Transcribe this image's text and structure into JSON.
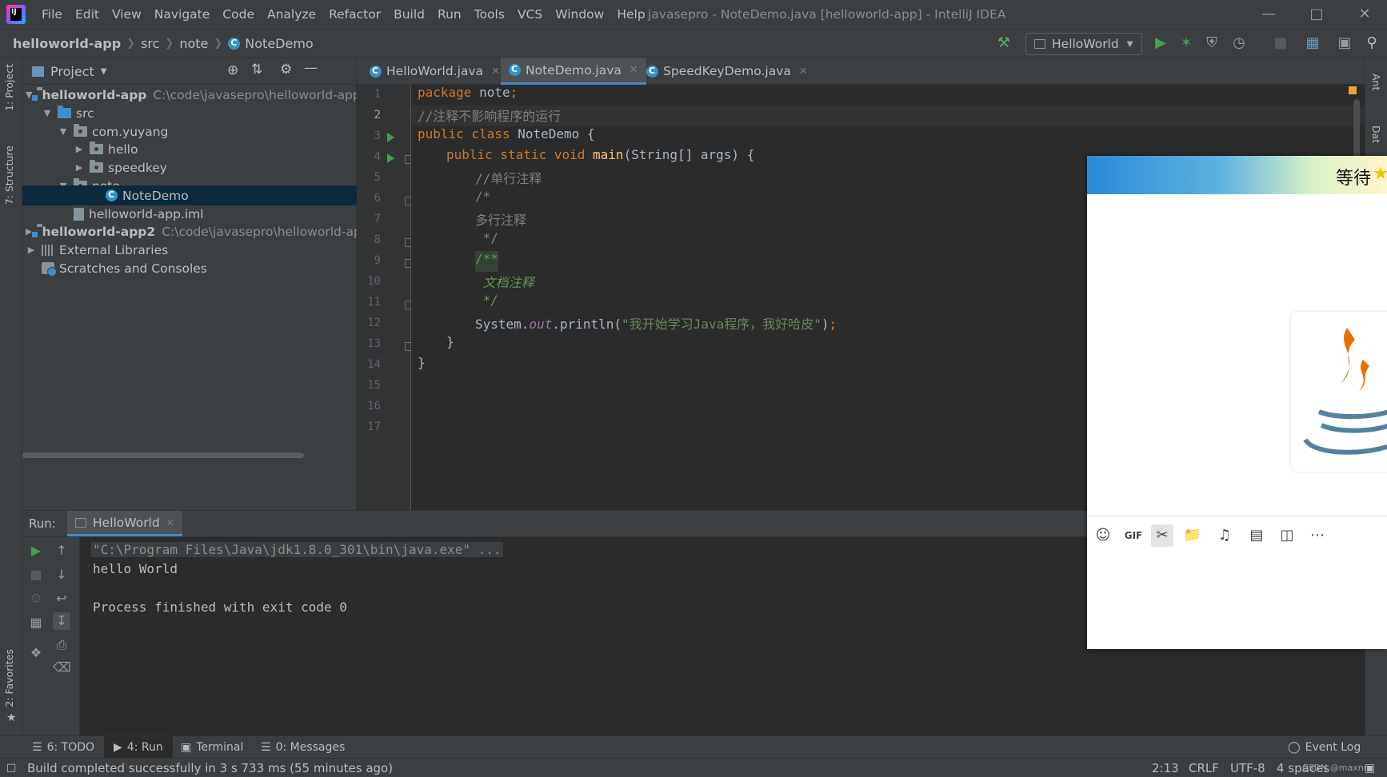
{
  "window": {
    "title": "javasepro - NoteDemo.java [helloworld-app] - IntelliJ IDEA",
    "menu": [
      "File",
      "Edit",
      "View",
      "Navigate",
      "Code",
      "Analyze",
      "Refactor",
      "Build",
      "Run",
      "Tools",
      "VCS",
      "Window",
      "Help"
    ]
  },
  "breadcrumb": [
    "helloworld-app",
    "src",
    "note",
    "NoteDemo"
  ],
  "toolbar": {
    "run_config": "HelloWorld"
  },
  "tool_tabs": {
    "project": "1: Project",
    "structure": "7: Structure",
    "favorites": "2: Favorites",
    "ant": "Ant",
    "database": "Dat"
  },
  "project": {
    "title": "Project",
    "tree": [
      {
        "label": "helloworld-app",
        "path": "C:\\code\\javasepro\\helloworld-app"
      },
      {
        "label": "src"
      },
      {
        "label": "com.yuyang"
      },
      {
        "label": "hello"
      },
      {
        "label": "speedkey"
      },
      {
        "label": "note"
      },
      {
        "label": "NoteDemo"
      },
      {
        "label": "helloworld-app.iml"
      },
      {
        "label": "helloworld-app2",
        "path": "C:\\code\\javasepro\\helloworld-app"
      },
      {
        "label": "External Libraries"
      },
      {
        "label": "Scratches and Consoles"
      }
    ]
  },
  "editor": {
    "tabs": [
      "HelloWorld.java",
      "NoteDemo.java",
      "SpeedKeyDemo.java"
    ],
    "active_tab": 1,
    "line_numbers": [
      "1",
      "2",
      "3",
      "4",
      "5",
      "6",
      "7",
      "8",
      "9",
      "10",
      "11",
      "12",
      "13",
      "14",
      "15",
      "16",
      "17"
    ],
    "current_line": 2,
    "code": {
      "l1_kw": "package",
      "l1_rest": " note",
      "l1_semi": ";",
      "l2": "//注释不影响程序的运行",
      "l3_kw": "public class",
      "l3_rest": " NoteDemo {",
      "l4_kw": "public static void",
      "l4_fn": " main",
      "l4_rest": "(String[] args) {",
      "l5": "//单行注释",
      "l6": "/*",
      "l7": "多行注释",
      "l8": " */",
      "l9": "/**",
      "l10": " 文档注释",
      "l11": " */",
      "l12_a": "System.",
      "l12_fld": "out",
      "l12_b": ".println(",
      "l12_str": "\"我开始学习Java程序，我好哈皮\"",
      "l12_c": ")",
      "l12_semi": ";",
      "l13": "}",
      "l14": "}"
    }
  },
  "run": {
    "label": "Run:",
    "tab": "HelloWorld",
    "console": [
      "\"C:\\Program Files\\Java\\jdk1.8.0_301\\bin\\java.exe\" ...",
      "hello World",
      "",
      "Process finished with exit code 0"
    ]
  },
  "bottom_tabs": {
    "todo": "6: TODO",
    "run": "4: Run",
    "terminal": "Terminal",
    "messages": "0: Messages",
    "event_log": "Event Log"
  },
  "status": {
    "message": "Build completed successfully in 3 s 733 ms (55 minutes ago)",
    "position": "2:13",
    "line_sep": "CRLF",
    "encoding": "UTF-8",
    "indent": "4 spaces",
    "watermark": "CSDN @maxnm"
  },
  "chat_window": {
    "title": "等待"
  },
  "colors": {
    "accent": "#4a88c7",
    "selection": "#0d293e",
    "run_green": "#499c54"
  }
}
